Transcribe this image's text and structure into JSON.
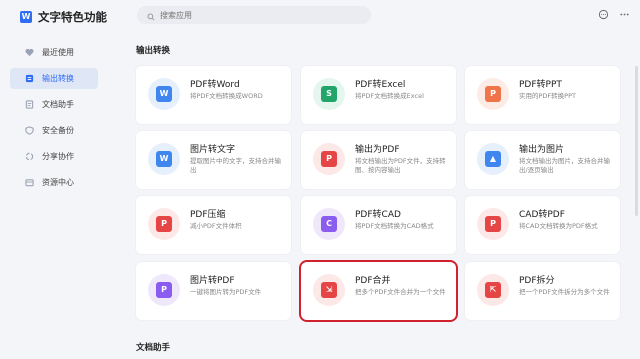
{
  "app": {
    "title": "文字特色功能",
    "logo_letter": "W"
  },
  "search": {
    "placeholder": "搜索应用"
  },
  "sidebar": {
    "items": [
      {
        "label": "最近使用",
        "icon": "heart-icon",
        "active": false
      },
      {
        "label": "输出转换",
        "icon": "convert-icon",
        "active": true
      },
      {
        "label": "文档助手",
        "icon": "document-icon",
        "active": false
      },
      {
        "label": "安全备份",
        "icon": "shield-icon",
        "active": false
      },
      {
        "label": "分享协作",
        "icon": "share-icon",
        "active": false
      },
      {
        "label": "资源中心",
        "icon": "resource-icon",
        "active": false
      }
    ]
  },
  "sections": [
    {
      "title": "输出转换"
    },
    {
      "title": "文档助手"
    }
  ],
  "cards": [
    {
      "title": "PDF转Word",
      "desc": "将PDF文档转换成WORD",
      "icon": "pdf-to-word-icon",
      "bg": "#e6f0fd",
      "fg": "#3f86ee",
      "glyph": "W"
    },
    {
      "title": "PDF转Excel",
      "desc": "将PDF文档转换成Excel",
      "icon": "pdf-to-excel-icon",
      "bg": "#e4f6ee",
      "fg": "#22a56a",
      "glyph": "S"
    },
    {
      "title": "PDF转PPT",
      "desc": "实用的PDF转换PPT",
      "icon": "pdf-to-ppt-icon",
      "bg": "#fdece6",
      "fg": "#f0744a",
      "glyph": "P"
    },
    {
      "title": "图片转文字",
      "desc": "提取图片中的文字，支持合并输出",
      "icon": "image-to-text-icon",
      "bg": "#e6f0fd",
      "fg": "#3f86ee",
      "glyph": "W"
    },
    {
      "title": "输出为PDF",
      "desc": "将文档输出为PDF文件，支持转图、按内容输出",
      "icon": "export-pdf-icon",
      "bg": "#fde8e8",
      "fg": "#e54545",
      "glyph": "P"
    },
    {
      "title": "输出为图片",
      "desc": "将文档输出为图片，支持合并输出/逐页输出",
      "icon": "export-image-icon",
      "bg": "#e6f0fd",
      "fg": "#3f86ee",
      "glyph": "▲"
    },
    {
      "title": "PDF压缩",
      "desc": "减小PDF文件体积",
      "icon": "pdf-compress-icon",
      "bg": "#fde8e8",
      "fg": "#e54545",
      "glyph": "P"
    },
    {
      "title": "PDF转CAD",
      "desc": "将PDF文档转换为CAD格式",
      "icon": "pdf-to-cad-icon",
      "bg": "#efe8fb",
      "fg": "#8b5cf0",
      "glyph": "C"
    },
    {
      "title": "CAD转PDF",
      "desc": "将CAD文档转换为PDF格式",
      "icon": "cad-to-pdf-icon",
      "bg": "#fde8e8",
      "fg": "#e54545",
      "glyph": "P"
    },
    {
      "title": "图片转PDF",
      "desc": "一键将图片转为PDF文件",
      "icon": "image-to-pdf-icon",
      "bg": "#efe8fb",
      "fg": "#8b5cf0",
      "glyph": "P"
    },
    {
      "title": "PDF合并",
      "desc": "把多个PDF文件合并为一个文件",
      "icon": "pdf-merge-icon",
      "bg": "#fde8e8",
      "fg": "#e54545",
      "glyph": "⇲",
      "selected": true
    },
    {
      "title": "PDF拆分",
      "desc": "把一个PDF文件拆分为多个文件",
      "icon": "pdf-split-icon",
      "bg": "#fde8e8",
      "fg": "#e54545",
      "glyph": "⇱"
    }
  ],
  "colors": {
    "accent": "#2f6df5",
    "selected_border": "#d0222e"
  },
  "top_icons": [
    "chat-icon",
    "more-icon"
  ]
}
